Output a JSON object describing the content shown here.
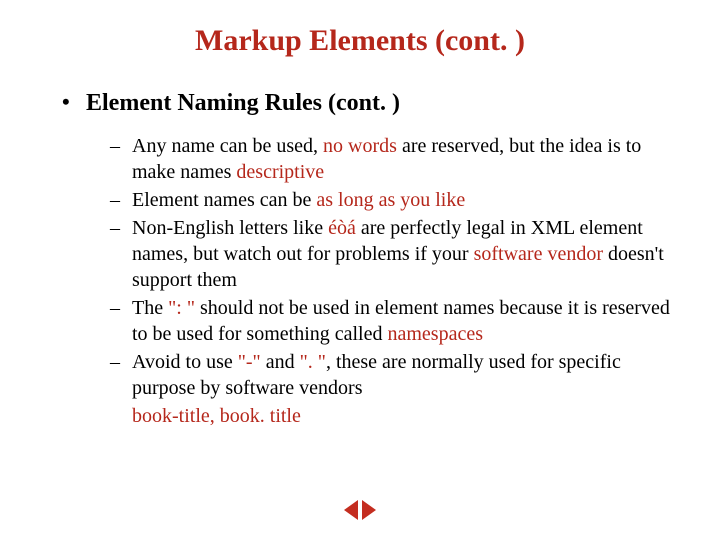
{
  "title": "Markup Elements (cont. )",
  "section_heading": "Element Naming Rules (cont. )",
  "bullets": {
    "b1_pre": "Any name can be used, ",
    "b1_h1": "no words",
    "b1_mid": " are reserved, but the idea is to make names ",
    "b1_h2": "descriptive",
    "b2_pre": "Element names can be ",
    "b2_h1": "as long as you like",
    "b3_pre": "Non-English letters like ",
    "b3_h1": "éòá",
    "b3_mid": " are perfectly legal in XML element names, but watch out for problems if your ",
    "b3_h2": "software vendor",
    "b3_post": " doesn't support them",
    "b4_pre": "The ",
    "b4_h1": "\": \"",
    "b4_mid": " should not be used in element names because it is reserved to be used for something called ",
    "b4_h2": "namespaces",
    "b5_pre": "Avoid to use ",
    "b5_h1": "\"-\"",
    "b5_mid1": " and ",
    "b5_h2": "\". \"",
    "b5_mid2": ", these are normally used for specific purpose by software vendors"
  },
  "example": "book-title,  book. title",
  "nav": {
    "prev": "previous-slide",
    "next": "next-slide"
  }
}
